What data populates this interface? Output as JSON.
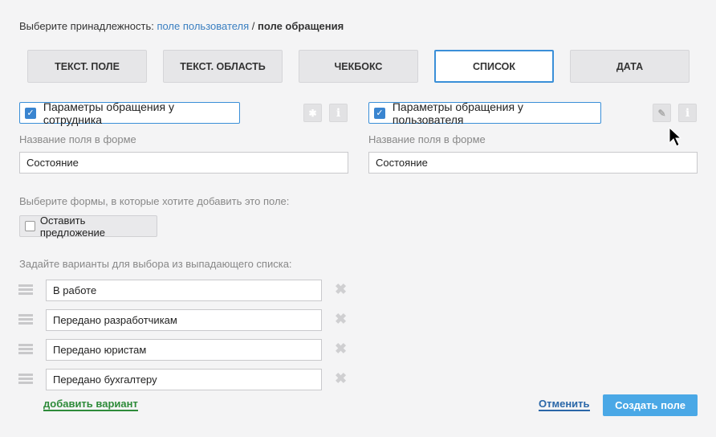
{
  "breadcrumb": {
    "prefix": "Выберите принадлежность:",
    "link": "поле пользователя",
    "sep": " / ",
    "current": "поле обращения"
  },
  "tabs": [
    {
      "label": "ТЕКСТ. ПОЛЕ"
    },
    {
      "label": "ТЕКСТ. ОБЛАСТЬ"
    },
    {
      "label": "ЧЕКБОКС"
    },
    {
      "label": "СПИСОК",
      "active": true
    },
    {
      "label": "ДАТА"
    }
  ],
  "left": {
    "checkbox_label": "Параметры обращения у сотрудника",
    "checked": true,
    "field_label": "Название поля в форме",
    "field_value": "Состояние"
  },
  "right": {
    "checkbox_label": "Параметры обращения у пользователя",
    "checked": true,
    "field_label": "Название поля в форме",
    "field_value": "Состояние"
  },
  "forms": {
    "label": "Выберите формы, в которые хотите добавить это поле:",
    "option": "Оставить предложение",
    "checked": false
  },
  "options": {
    "label": "Задайте варианты для выбора из выпадающего списка:",
    "items": [
      "В работе",
      "Передано разработчикам",
      "Передано юристам",
      "Передано бухгалтеру"
    ],
    "add_label": "добавить вариант"
  },
  "actions": {
    "cancel": "Отменить",
    "create": "Создать поле"
  },
  "colors": {
    "accent": "#3a8fd8",
    "primary_button": "#4aa8e6",
    "add_link": "#2e8b3a"
  }
}
